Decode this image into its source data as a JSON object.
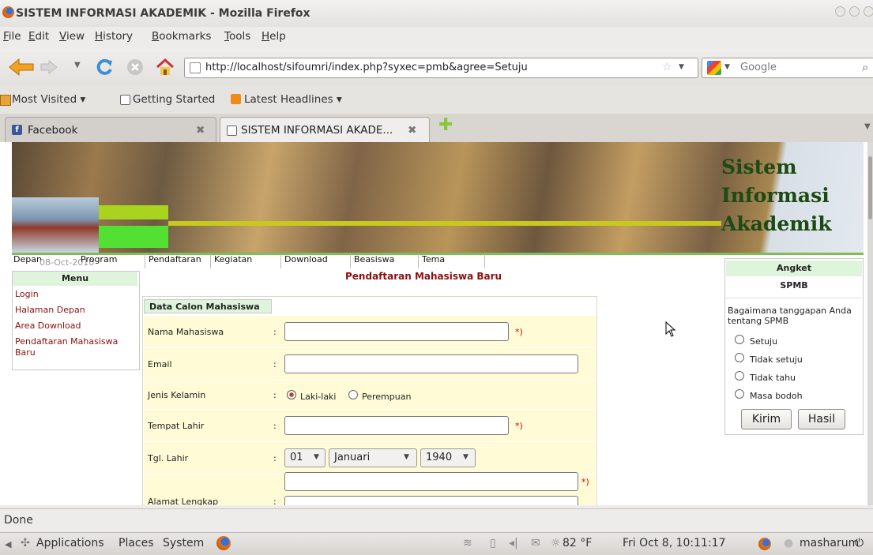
{
  "window": {
    "title": "SISTEM INFORMASI AKADEMIK - Mozilla Firefox"
  },
  "menubar": [
    "File",
    "Edit",
    "View",
    "History",
    "Bookmarks",
    "Tools",
    "Help"
  ],
  "navbar": {
    "url": "http://localhost/sifoumri/index.php?syxec=pmb&agree=Setuju",
    "search_placeholder": "Google"
  },
  "bookmarks": [
    "Most Visited ▾",
    "Getting Started",
    "Latest Headlines ▾"
  ],
  "tabs": [
    {
      "label": "Facebook"
    },
    {
      "label": "SISTEM INFORMASI AKADE..."
    }
  ],
  "banner": {
    "logo": [
      "Sistem",
      "Informasi",
      "Akademik"
    ]
  },
  "site_nav": {
    "date": "08-Oct-2010",
    "items": [
      "Depan",
      "Program",
      "Pendaftaran",
      "Kegiatan",
      "Download",
      "Beasiswa",
      "Tema"
    ]
  },
  "left_menu": {
    "title": "Menu",
    "items": [
      "Login",
      "Halaman Depan",
      "Area Download",
      "Pendaftaran Mahasiswa",
      "Baru"
    ]
  },
  "form": {
    "page_title": "Pendaftaran Mahasiswa Baru",
    "section_title": "Data Calon Mahasiswa",
    "colon": ":",
    "required_mark": "*)",
    "labels": {
      "nama": "Nama Mahasiswa",
      "email": "Email",
      "jenis_kelamin": "Jenis Kelamin",
      "tempat_lahir": "Tempat Lahir",
      "tgl_lahir": "Tgl. Lahir",
      "alamat": "Alamat Lengkap"
    },
    "gender_options": [
      "Laki-laki",
      "Perempuan"
    ],
    "gender_selected": "Laki-laki",
    "tgl": {
      "day": "01",
      "month": "Januari",
      "year": "1940"
    }
  },
  "angket": {
    "title": "Angket",
    "subtitle": "SPMB",
    "question": [
      "Bagaimana tanggapan Anda",
      "tentang SPMB"
    ],
    "options": [
      "Setuju",
      "Tidak setuju",
      "Tidak tahu",
      "Masa bodoh"
    ],
    "buttons": {
      "submit": "Kirim",
      "result": "Hasil"
    }
  },
  "statusbar": {
    "text": "Done"
  },
  "panel": {
    "menus": [
      "Applications",
      "Places",
      "System"
    ],
    "weather": "82 °F",
    "clock": "Fri Oct  8, 10:11:17",
    "user": "masharum"
  }
}
